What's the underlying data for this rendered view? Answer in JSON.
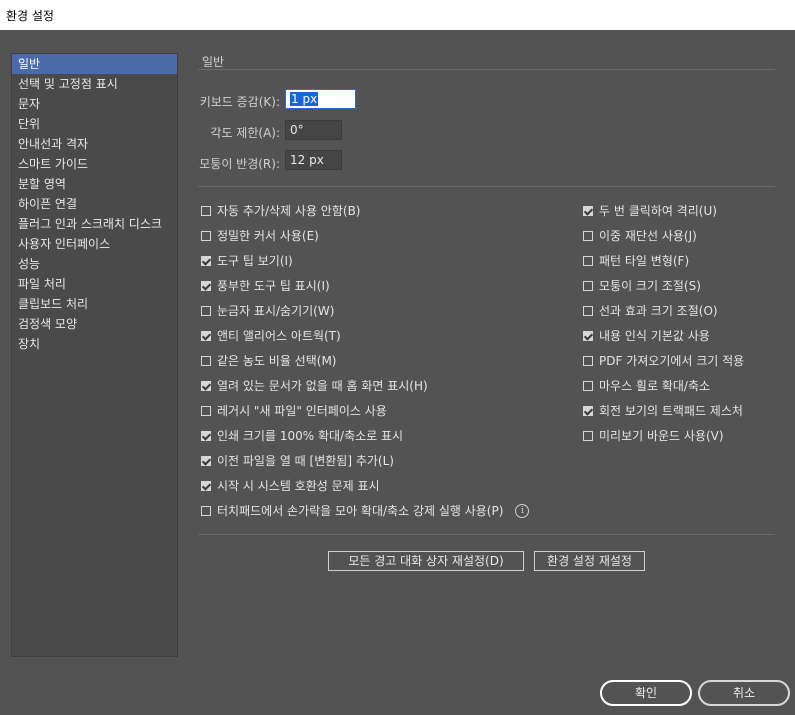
{
  "window": {
    "title": "환경 설정"
  },
  "sidebar": {
    "items": [
      {
        "label": "일반",
        "selected": true
      },
      {
        "label": "선택 및 고정점 표시"
      },
      {
        "label": "문자"
      },
      {
        "label": "단위"
      },
      {
        "label": "안내선과 격자"
      },
      {
        "label": "스마트 가이드"
      },
      {
        "label": "분할 영역"
      },
      {
        "label": "하이픈 연결"
      },
      {
        "label": "플러그 인과 스크래치 디스크"
      },
      {
        "label": "사용자 인터페이스"
      },
      {
        "label": "성능"
      },
      {
        "label": "파일 처리"
      },
      {
        "label": "클립보드 처리"
      },
      {
        "label": "검정색 모양"
      },
      {
        "label": "장치"
      }
    ]
  },
  "general": {
    "section_title": "일반",
    "keyboard_increment": {
      "label": "키보드 증감(K):",
      "value": "1 px"
    },
    "constrain_angle": {
      "label": "각도 제한(A):",
      "value": "0°"
    },
    "corner_radius": {
      "label": "모퉁이 반경(R):",
      "value": "12 px"
    }
  },
  "left_checkboxes": [
    {
      "label": "자동 추가/삭제 사용 안함(B)",
      "checked": false
    },
    {
      "label": "정밀한 커서 사용(E)",
      "checked": false
    },
    {
      "label": "도구 팁 보기(I)",
      "checked": true
    },
    {
      "label": "풍부한 도구 팁 표시(I)",
      "checked": true
    },
    {
      "label": "눈금자 표시/숨기기(W)",
      "checked": false
    },
    {
      "label": "앤티 앨리어스 아트웍(T)",
      "checked": true
    },
    {
      "label": "같은 농도 비율 선택(M)",
      "checked": false
    },
    {
      "label": "열려 있는 문서가 없을 때 홈 화면 표시(H)",
      "checked": true
    },
    {
      "label": "레거시 \"새 파일\" 인터페이스 사용",
      "checked": false
    },
    {
      "label": "인쇄 크기를 100% 확대/축소로 표시",
      "checked": true
    },
    {
      "label": "이전 파일을 열 때 [변환됨] 추가(L)",
      "checked": true
    },
    {
      "label": "시작 시 시스템 호환성 문제 표시",
      "checked": true
    },
    {
      "label": "터치패드에서 손가락을 모아 확대/축소 강제 실행 사용(P)",
      "checked": false,
      "info_icon": "i"
    }
  ],
  "right_checkboxes": [
    {
      "label": "두 번 클릭하여 격리(U)",
      "checked": true
    },
    {
      "label": "이중 재단선 사용(J)",
      "checked": false
    },
    {
      "label": "패턴 타일 변형(F)",
      "checked": false
    },
    {
      "label": "모퉁이 크기 조절(S)",
      "checked": false
    },
    {
      "label": "선과 효과 크기 조절(O)",
      "checked": false
    },
    {
      "label": "내용 인식 기본값 사용",
      "checked": true
    },
    {
      "label": "PDF 가져오기에서 크기 적용",
      "checked": false
    },
    {
      "label": "마우스 휠로 확대/축소",
      "checked": false
    },
    {
      "label": "회전 보기의 트랙패드 제스처",
      "checked": true
    },
    {
      "label": "미리보기 바운드 사용(V)",
      "checked": false
    }
  ],
  "buttons": {
    "reset_warnings": "모든 경고 대화 상자 재설정(D)",
    "reset_preferences": "환경 설정 재설정",
    "ok": "확인",
    "cancel": "취소"
  }
}
